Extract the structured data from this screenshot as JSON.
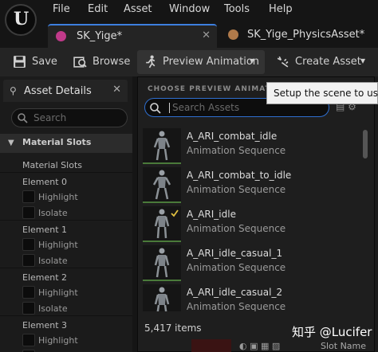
{
  "menubar": {
    "items": [
      "File",
      "Edit",
      "Asset",
      "Window",
      "Tools",
      "Help"
    ]
  },
  "tabs": [
    {
      "label": "SK_Yige*",
      "color": "#c03a8a",
      "closable": true,
      "active": true
    },
    {
      "label": "SK_Yige_PhysicsAsset*",
      "color": "#b07a4a",
      "closable": false,
      "active": false
    }
  ],
  "toolbar": {
    "save_label": "Save",
    "browse_label": "Browse",
    "preview_label": "Preview Animation",
    "create_label": "Create Asset"
  },
  "left_panel": {
    "tab_label": "Asset Details",
    "search_placeholder": "Search",
    "section_label": "Material Slots",
    "slots_label": "Material Slots",
    "elements": [
      {
        "name": "Element 0",
        "highlight": "Highlight",
        "isolate": "Isolate"
      },
      {
        "name": "Element 1",
        "highlight": "Highlight",
        "isolate": "Isolate"
      },
      {
        "name": "Element 2",
        "highlight": "Highlight",
        "isolate": "Isolate"
      },
      {
        "name": "Element 3",
        "highlight": "Highlight",
        "isolate": ""
      }
    ]
  },
  "dropdown": {
    "header": "CHOOSE PREVIEW ANIMATION",
    "search_placeholder": "Search Assets",
    "items": [
      {
        "name": "A_ARI_combat_idle",
        "type": "Animation Sequence"
      },
      {
        "name": "A_ARI_combat_to_idle",
        "type": "Animation Sequence"
      },
      {
        "name": "A_ARI_idle",
        "type": "Animation Sequence"
      },
      {
        "name": "A_ARI_idle_casual_1",
        "type": "Animation Sequence"
      },
      {
        "name": "A_ARI_idle_casual_2",
        "type": "Animation Sequence"
      }
    ],
    "count": "5,417 items"
  },
  "tooltip": "Setup the scene to use a",
  "bottom": {
    "slot_name": "Slot Name"
  },
  "watermark": "知乎 @Lucifer",
  "colors": {
    "accent": "#2f6fd0",
    "background": "#151515",
    "panel": "#242424"
  }
}
